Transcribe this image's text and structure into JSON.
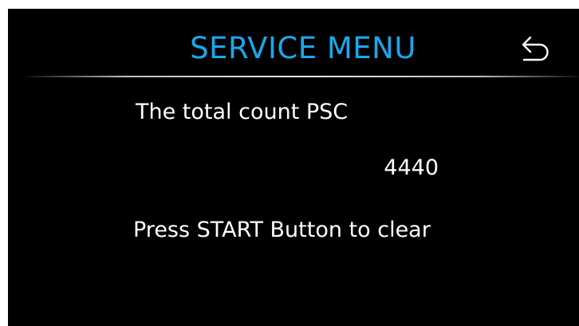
{
  "header": {
    "title": "SERVICE MENU",
    "back_icon": "return-arrow-icon"
  },
  "content": {
    "count_label": "The total count PSC",
    "count_value": "4440",
    "instruction": "Press START Button to clear"
  },
  "colors": {
    "background": "#000000",
    "title": "#1aa7ec",
    "text": "#ffffff"
  }
}
